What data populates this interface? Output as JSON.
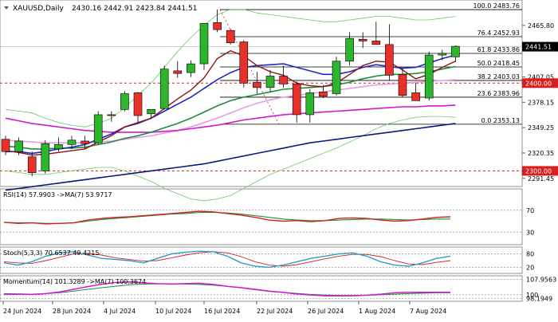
{
  "header": {
    "symbol": "XAUUSD,Daily",
    "ohlc": "2430.16 2442.91 2423.84 2441.51"
  },
  "price_axis": {
    "ticks": [
      "2465.80",
      "2407.05",
      "2378.15",
      "2349.25",
      "2320.35",
      "2291.45"
    ],
    "current_price": "2441.51",
    "level_2400": "2400.00",
    "level_2300": "2300.00"
  },
  "fibonacci": [
    {
      "label": "100.0 2483.76",
      "price": 2483.76
    },
    {
      "label": "76.4 2452.93",
      "price": 2452.93
    },
    {
      "label": "61.8 2433.86",
      "price": 2433.86
    },
    {
      "label": "50.0 2418.45",
      "price": 2418.45
    },
    {
      "label": "38.2 2403.03",
      "price": 2403.03
    },
    {
      "label": "23.6 2383.96",
      "price": 2383.96
    },
    {
      "label": "0.0 2353.13",
      "price": 2353.13
    }
  ],
  "rsi": {
    "label": "RSI(14) 57.9903  ->MA(7) 53.9717",
    "ticks": [
      "70",
      "30"
    ],
    "values": [
      48,
      46,
      47,
      45,
      46,
      47,
      52,
      55,
      57,
      58,
      60,
      62,
      64,
      66,
      68,
      67,
      64,
      61,
      57,
      52,
      50,
      51,
      49,
      51,
      55,
      56,
      55,
      52,
      50,
      51,
      54,
      57,
      58
    ],
    "ma": [
      48,
      47,
      47,
      46,
      46,
      47,
      50,
      53,
      55,
      57,
      59,
      61,
      63,
      64,
      66,
      66,
      65,
      63,
      60,
      57,
      54,
      52,
      51,
      51,
      52,
      53,
      54,
      54,
      53,
      52,
      53,
      54,
      54
    ]
  },
  "stoch": {
    "label": "Stoch(5,3,3) 70.6537 49.4215",
    "ticks": [
      "80",
      "20"
    ],
    "k": [
      40,
      30,
      45,
      70,
      85,
      90,
      75,
      60,
      55,
      50,
      40,
      60,
      80,
      88,
      92,
      90,
      70,
      40,
      25,
      20,
      30,
      45,
      60,
      70,
      80,
      85,
      70,
      45,
      30,
      25,
      40,
      60,
      70
    ],
    "d": [
      45,
      40,
      38,
      50,
      65,
      80,
      82,
      75,
      62,
      55,
      48,
      50,
      62,
      75,
      85,
      90,
      85,
      68,
      45,
      30,
      25,
      32,
      45,
      58,
      70,
      78,
      78,
      68,
      50,
      35,
      32,
      42,
      50
    ]
  },
  "momentum": {
    "label": "Momentum(14) 101.3289  ->MA(7) 100.3674",
    "ticks": [
      "107.9563",
      "100",
      "98.1949"
    ],
    "values": [
      100.5,
      100.4,
      100.2,
      100.6,
      101.5,
      102.8,
      104.2,
      105.4,
      106.3,
      106.6,
      106.1,
      105.7,
      105.5,
      105.7,
      105.9,
      105.3,
      104.3,
      103.6,
      102.7,
      101.8,
      101.2,
      100.4,
      99.9,
      99.5,
      99.4,
      99.5,
      99.8,
      100.3,
      101.0,
      101.3,
      101.3,
      101.3,
      101.3
    ],
    "ma": [
      100.1,
      100.2,
      100.3,
      100.6,
      101.1,
      101.9,
      102.8,
      103.6,
      104.4,
      105.1,
      105.5,
      105.6,
      105.6,
      105.5,
      105.3,
      104.9,
      104.3,
      103.7,
      102.9,
      102.0,
      101.3,
      100.7,
      100.2,
      99.9,
      99.7,
      99.7,
      99.8,
      100.0,
      100.3,
      100.6,
      100.8,
      101.0,
      101.0
    ]
  },
  "dates": [
    "24 Jun 2024",
    "28 Jun 2024",
    "4 Jul 2024",
    "10 Jul 2024",
    "16 Jul 2024",
    "22 Jul 2024",
    "26 Jul 2024",
    "1 Aug 2024",
    "7 Aug 2024"
  ],
  "colors": {
    "bull": "#2db52d",
    "bear": "#e8312a",
    "ma_blue": "#1e28c8",
    "ma_green": "#1f8c3a",
    "ma_darkred": "#8c1414",
    "ma_magenta": "#d01ad0",
    "ma_violet": "#e89ae8",
    "ma_navy": "#0a1a7a",
    "bb": "#6cc86c",
    "rsi": "#d42020",
    "rsi_ma": "#1f8c3a",
    "stoch_k": "#2aa0c8",
    "stoch_d": "#d42020",
    "momentum": "#d01ad0",
    "momentum_ma": "#1f8c3a"
  },
  "chart_data": {
    "type": "candlestick",
    "title": "XAUUSD,Daily",
    "ylim": [
      2284,
      2492
    ],
    "candles": [
      {
        "o": 2336,
        "h": 2340,
        "l": 2318,
        "c": 2322
      },
      {
        "o": 2322,
        "h": 2338,
        "l": 2318,
        "c": 2334
      },
      {
        "o": 2316,
        "h": 2322,
        "l": 2294,
        "c": 2298
      },
      {
        "o": 2300,
        "h": 2335,
        "l": 2297,
        "c": 2331
      },
      {
        "o": 2325,
        "h": 2338,
        "l": 2322,
        "c": 2330
      },
      {
        "o": 2330,
        "h": 2340,
        "l": 2325,
        "c": 2335
      },
      {
        "o": 2334,
        "h": 2340,
        "l": 2325,
        "c": 2331
      },
      {
        "o": 2332,
        "h": 2368,
        "l": 2330,
        "c": 2364
      },
      {
        "o": 2364,
        "h": 2368,
        "l": 2356,
        "c": 2363
      },
      {
        "o": 2370,
        "h": 2391,
        "l": 2368,
        "c": 2388
      },
      {
        "o": 2389,
        "h": 2390,
        "l": 2355,
        "c": 2363
      },
      {
        "o": 2365,
        "h": 2370,
        "l": 2359,
        "c": 2370
      },
      {
        "o": 2371,
        "h": 2420,
        "l": 2370,
        "c": 2416
      },
      {
        "o": 2414,
        "h": 2425,
        "l": 2406,
        "c": 2411
      },
      {
        "o": 2412,
        "h": 2426,
        "l": 2407,
        "c": 2422
      },
      {
        "o": 2422,
        "h": 2451,
        "l": 2415,
        "c": 2468
      },
      {
        "o": 2469,
        "h": 2484,
        "l": 2458,
        "c": 2461
      },
      {
        "o": 2460,
        "h": 2462,
        "l": 2444,
        "c": 2446
      },
      {
        "o": 2447,
        "h": 2449,
        "l": 2395,
        "c": 2400
      },
      {
        "o": 2401,
        "h": 2413,
        "l": 2388,
        "c": 2395
      },
      {
        "o": 2395,
        "h": 2415,
        "l": 2390,
        "c": 2408
      },
      {
        "o": 2408,
        "h": 2420,
        "l": 2395,
        "c": 2399
      },
      {
        "o": 2399,
        "h": 2402,
        "l": 2355,
        "c": 2364
      },
      {
        "o": 2364,
        "h": 2393,
        "l": 2355,
        "c": 2389
      },
      {
        "o": 2390,
        "h": 2398,
        "l": 2383,
        "c": 2385
      },
      {
        "o": 2388,
        "h": 2430,
        "l": 2386,
        "c": 2425
      },
      {
        "o": 2425,
        "h": 2458,
        "l": 2420,
        "c": 2451
      },
      {
        "o": 2450,
        "h": 2458,
        "l": 2440,
        "c": 2448
      },
      {
        "o": 2448,
        "h": 2470,
        "l": 2444,
        "c": 2444
      },
      {
        "o": 2444,
        "h": 2467,
        "l": 2403,
        "c": 2409
      },
      {
        "o": 2410,
        "h": 2417,
        "l": 2384,
        "c": 2386
      },
      {
        "o": 2389,
        "h": 2400,
        "l": 2380,
        "c": 2380
      },
      {
        "o": 2383,
        "h": 2436,
        "l": 2380,
        "c": 2432
      },
      {
        "o": 2432,
        "h": 2438,
        "l": 2426,
        "c": 2434
      },
      {
        "o": 2430,
        "h": 2443,
        "l": 2424,
        "c": 2442
      }
    ],
    "ma_blue": [
      2322,
      2322,
      2320,
      2322,
      2325,
      2327,
      2330,
      2336,
      2342,
      2350,
      2354,
      2360,
      2368,
      2376,
      2384,
      2394,
      2404,
      2412,
      2418,
      2420,
      2421,
      2422,
      2418,
      2414,
      2410,
      2410,
      2413,
      2418,
      2421,
      2419,
      2417,
      2418,
      2423,
      2428,
      2432
    ],
    "ma_green": [
      2328,
      2327,
      2325,
      2325,
      2326,
      2326,
      2327,
      2330,
      2333,
      2337,
      2340,
      2344,
      2349,
      2354,
      2360,
      2367,
      2374,
      2380,
      2384,
      2387,
      2390,
      2393,
      2394,
      2395,
      2396,
      2398,
      2401,
      2405,
      2408,
      2410,
      2410,
      2411,
      2413,
      2416,
      2419
    ],
    "ma_darkred": [
      2323,
      2321,
      2318,
      2319,
      2321,
      2323,
      2325,
      2333,
      2340,
      2350,
      2355,
      2360,
      2371,
      2382,
      2392,
      2406,
      2428,
      2437,
      2431,
      2420,
      2413,
      2409,
      2400,
      2397,
      2396,
      2400,
      2410,
      2420,
      2425,
      2424,
      2415,
      2405,
      2410,
      2418,
      2425
    ],
    "ma_magenta": [
      2360,
      2357,
      2354,
      2352,
      2350,
      2348,
      2346,
      2345,
      2344,
      2344,
      2344,
      2344,
      2345,
      2346,
      2348,
      2350,
      2352,
      2355,
      2358,
      2360,
      2362,
      2364,
      2365,
      2366,
      2367,
      2368,
      2369,
      2370,
      2371,
      2372,
      2373,
      2373,
      2374,
      2374,
      2375
    ],
    "ma_violet": [
      2335,
      2334,
      2333,
      2332,
      2332,
      2332,
      2332,
      2333,
      2334,
      2336,
      2338,
      2340,
      2343,
      2346,
      2350,
      2355,
      2360,
      2366,
      2372,
      2377,
      2381,
      2384,
      2386,
      2388,
      2390,
      2392,
      2394,
      2396,
      2398,
      2399,
      2400,
      2401,
      2402,
      2403,
      2404
    ],
    "ma_navy": [
      2278,
      2280,
      2282,
      2284,
      2286,
      2288,
      2290,
      2292,
      2294,
      2296,
      2298,
      2300,
      2302,
      2304,
      2306,
      2308,
      2311,
      2314,
      2317,
      2320,
      2323,
      2326,
      2329,
      2332,
      2334,
      2336,
      2338,
      2340,
      2342,
      2344,
      2346,
      2348,
      2350,
      2352,
      2354
    ],
    "bb_upper": [
      2370,
      2368,
      2366,
      2360,
      2355,
      2352,
      2350,
      2354,
      2360,
      2372,
      2386,
      2400,
      2418,
      2436,
      2452,
      2466,
      2478,
      2484,
      2484,
      2480,
      2478,
      2476,
      2474,
      2472,
      2470,
      2470,
      2472,
      2474,
      2476,
      2476,
      2474,
      2472,
      2472,
      2474,
      2476
    ],
    "bb_lower": [
      2300,
      2298,
      2296,
      2296,
      2298,
      2300,
      2302,
      2304,
      2304,
      2300,
      2294,
      2288,
      2280,
      2274,
      2268,
      2266,
      2268,
      2272,
      2280,
      2288,
      2296,
      2302,
      2308,
      2314,
      2320,
      2326,
      2333,
      2340,
      2348,
      2354,
      2358,
      2361,
      2362,
      2362,
      2361
    ]
  }
}
